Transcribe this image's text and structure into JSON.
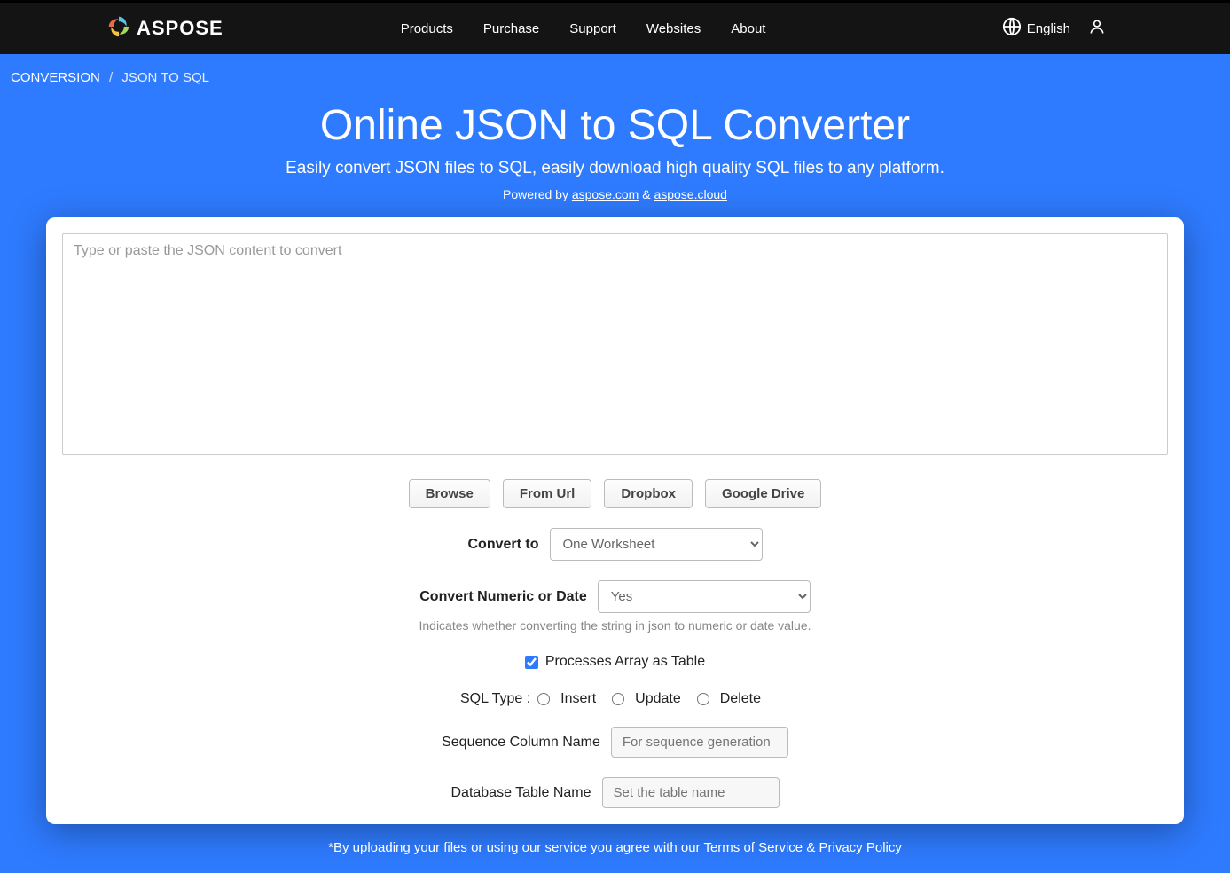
{
  "header": {
    "brand": "ASPOSE",
    "nav": [
      "Products",
      "Purchase",
      "Support",
      "Websites",
      "About"
    ],
    "lang": "English"
  },
  "breadcrumb": {
    "root": "CONVERSION",
    "current": "JSON TO SQL"
  },
  "hero": {
    "title": "Online JSON to SQL Converter",
    "subtitle": "Easily convert JSON files to SQL, easily download high quality SQL files to any platform.",
    "powered_prefix": "Powered by ",
    "link1": "aspose.com",
    "amp": " & ",
    "link2": "aspose.cloud"
  },
  "form": {
    "json_placeholder": "Type or paste the JSON content to convert",
    "buttons": {
      "browse": "Browse",
      "from_url": "From Url",
      "dropbox": "Dropbox",
      "gdrive": "Google Drive"
    },
    "convert_to_label": "Convert to",
    "convert_to_value": "One Worksheet",
    "convert_numdate_label": "Convert Numeric or Date",
    "convert_numdate_value": "Yes",
    "convert_numdate_hint": "Indicates whether converting the string in json to numeric or date value.",
    "array_table_label": "Processes Array as Table",
    "sql_type_label": "SQL Type : ",
    "sql_type_options": [
      "Insert",
      "Update",
      "Delete"
    ],
    "seq_label": "Sequence Column Name",
    "seq_placeholder": "For sequence generation",
    "table_label": "Database Table Name",
    "table_placeholder": "Set the table name"
  },
  "disclaimer": {
    "prefix": "*By uploading your files or using our service you agree with our ",
    "tos": "Terms of Service",
    "amp": " & ",
    "privacy": "Privacy Policy"
  }
}
